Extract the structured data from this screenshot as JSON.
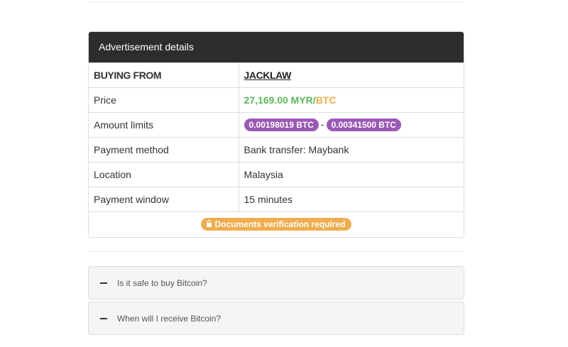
{
  "panel": {
    "title": "Advertisement details",
    "rows": {
      "buying_from": {
        "label": "BUYING FROM",
        "value": "JACKLAW"
      },
      "price": {
        "label": "Price",
        "amount": "27,169.00 MYR",
        "slash": "/",
        "currency": "BTC"
      },
      "amount_limits": {
        "label": "Amount limits",
        "min": "0.00198019 BTC",
        "separator": "-",
        "max": "0.00341500 BTC"
      },
      "payment_method": {
        "label": "Payment method",
        "value": "Bank transfer: Maybank"
      },
      "location": {
        "label": "Location",
        "value": "Malaysia"
      },
      "payment_window": {
        "label": "Payment window",
        "value": "15 minutes"
      }
    },
    "verification_badge": "Documents verification required"
  },
  "faq": [
    {
      "question": "Is it safe to buy Bitcoin?"
    },
    {
      "question": "When will I receive Bitcoin?"
    }
  ],
  "colors": {
    "header_bg": "#2d2d2d",
    "price_green": "#5cb85c",
    "btc_orange": "#f0ad4e",
    "limit_purple": "#9b59b6",
    "warning_orange": "#f0ad4e"
  },
  "icons": {
    "verification": "lock-icon",
    "faq_toggle": "minus-icon"
  }
}
